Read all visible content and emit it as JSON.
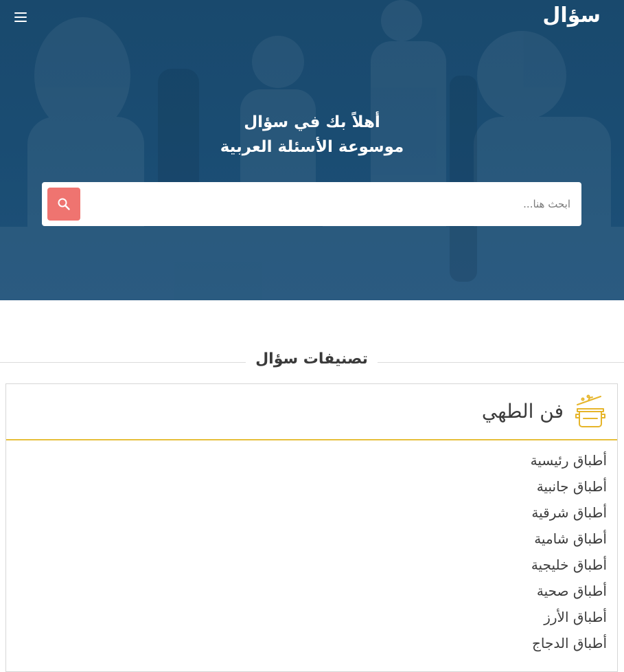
{
  "header": {
    "logo_text": "سؤال",
    "menu_icon": "hamburger-menu-icon"
  },
  "hero": {
    "line1": "أهلاً بك في سؤال",
    "line2": "موسوعة الأسئلة العربية",
    "background_color": "#1a4c72"
  },
  "search": {
    "placeholder": "ابحث هنا...",
    "value": "",
    "button_icon": "search-icon",
    "button_color": "#ef7470"
  },
  "categories_section": {
    "title": "تصنيفات سؤال"
  },
  "category_card": {
    "title": "فن الطهي",
    "icon": "cooking-pot-icon",
    "accent_color": "#e6bf3a",
    "items": [
      "أطباق رئيسية",
      "أطباق جانبية",
      "أطباق شرقية",
      "أطباق شامية",
      "أطباق خليجية",
      "أطباق صحية",
      "أطباق الأرز",
      "أطباق الدجاج"
    ]
  }
}
